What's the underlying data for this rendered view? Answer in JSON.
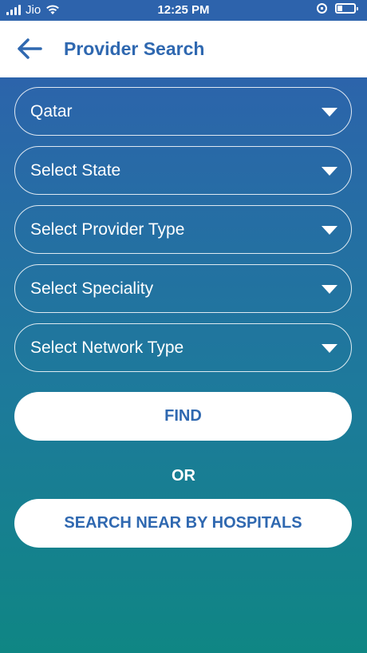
{
  "status_bar": {
    "carrier": "Jio",
    "time": "12:25 PM"
  },
  "header": {
    "title": "Provider Search"
  },
  "form": {
    "country": "Qatar",
    "state_placeholder": "Select State",
    "provider_type_placeholder": "Select Provider Type",
    "speciality_placeholder": "Select Speciality",
    "network_type_placeholder": "Select Network Type"
  },
  "actions": {
    "find_label": "FIND",
    "or_label": "OR",
    "nearby_label": "SEARCH NEAR BY HOSPITALS"
  },
  "colors": {
    "brand_blue": "#2f68b0",
    "gradient_top": "#2c64ab",
    "gradient_bottom": "#0f8684"
  }
}
